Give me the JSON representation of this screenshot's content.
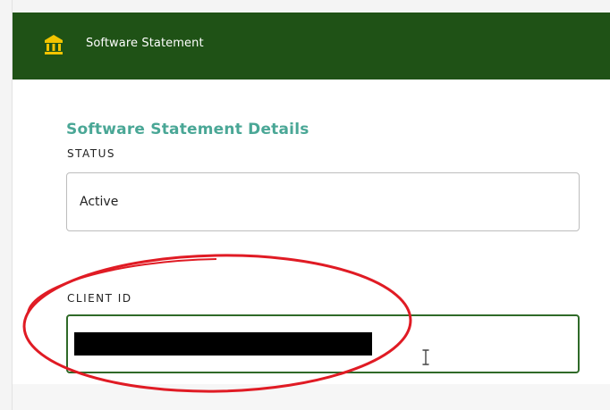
{
  "header": {
    "icon": "bank-icon",
    "title": "Software Statement"
  },
  "details": {
    "section_title": "Software Statement Details",
    "status": {
      "label": "STATUS",
      "value": "Active"
    },
    "client_id": {
      "label": "CLIENT ID",
      "value_redacted": true
    }
  },
  "colors": {
    "header_bg": "#1f5216",
    "header_icon": "#f2c400",
    "section_title": "#4aa796",
    "focused_border": "#2f6a28",
    "annotation": "#e01b24"
  },
  "icons": {
    "text_cursor": "text-cursor-icon"
  }
}
